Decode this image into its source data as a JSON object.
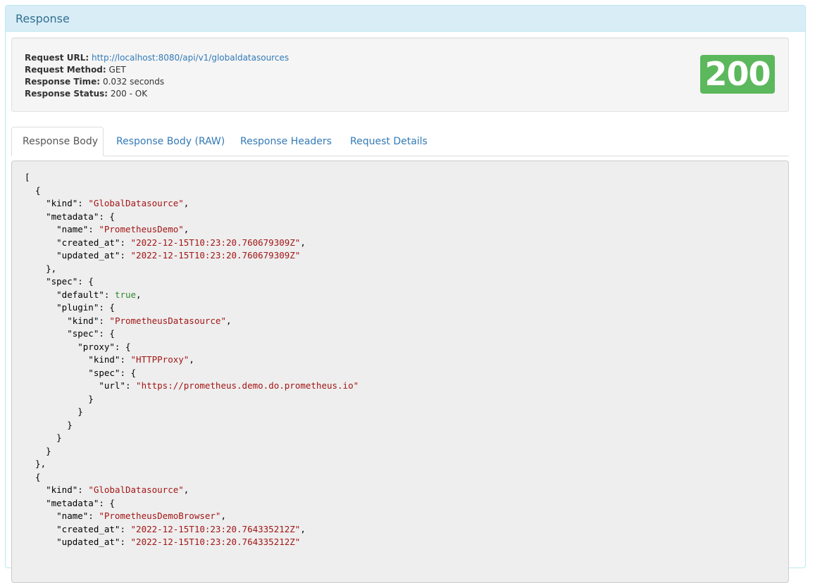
{
  "panel": {
    "title": "Response"
  },
  "summary": {
    "request_url_label": "Request URL:",
    "request_url": "http://localhost:8080/api/v1/globaldatasources",
    "request_method_label": "Request Method:",
    "request_method": "GET",
    "response_time_label": "Response Time:",
    "response_time": "0.032 seconds",
    "response_status_label": "Response Status:",
    "response_status": "200 - OK",
    "status_code": "200",
    "status_color": "#5cb85c"
  },
  "tabs": [
    {
      "label": "Response Body",
      "active": true
    },
    {
      "label": "Response Body (RAW)",
      "active": false
    },
    {
      "label": "Response Headers",
      "active": false
    },
    {
      "label": "Request Details",
      "active": false
    }
  ],
  "body_lines": [
    [
      {
        "t": "p",
        "v": "["
      }
    ],
    [
      {
        "t": "p",
        "v": "  {"
      }
    ],
    [
      {
        "t": "p",
        "v": "    \"kind\": "
      },
      {
        "t": "s",
        "v": "\"GlobalDatasource\""
      },
      {
        "t": "p",
        "v": ","
      }
    ],
    [
      {
        "t": "p",
        "v": "    \"metadata\": {"
      }
    ],
    [
      {
        "t": "p",
        "v": "      \"name\": "
      },
      {
        "t": "s",
        "v": "\"PrometheusDemo\""
      },
      {
        "t": "p",
        "v": ","
      }
    ],
    [
      {
        "t": "p",
        "v": "      \"created_at\": "
      },
      {
        "t": "s",
        "v": "\"2022-12-15T10:23:20.760679309Z\""
      },
      {
        "t": "p",
        "v": ","
      }
    ],
    [
      {
        "t": "p",
        "v": "      \"updated_at\": "
      },
      {
        "t": "s",
        "v": "\"2022-12-15T10:23:20.760679309Z\""
      }
    ],
    [
      {
        "t": "p",
        "v": "    },"
      }
    ],
    [
      {
        "t": "p",
        "v": "    \"spec\": {"
      }
    ],
    [
      {
        "t": "p",
        "v": "      \"default\": "
      },
      {
        "t": "b",
        "v": "true"
      },
      {
        "t": "p",
        "v": ","
      }
    ],
    [
      {
        "t": "p",
        "v": "      \"plugin\": {"
      }
    ],
    [
      {
        "t": "p",
        "v": "        \"kind\": "
      },
      {
        "t": "s",
        "v": "\"PrometheusDatasource\""
      },
      {
        "t": "p",
        "v": ","
      }
    ],
    [
      {
        "t": "p",
        "v": "        \"spec\": {"
      }
    ],
    [
      {
        "t": "p",
        "v": "          \"proxy\": {"
      }
    ],
    [
      {
        "t": "p",
        "v": "            \"kind\": "
      },
      {
        "t": "s",
        "v": "\"HTTPProxy\""
      },
      {
        "t": "p",
        "v": ","
      }
    ],
    [
      {
        "t": "p",
        "v": "            \"spec\": {"
      }
    ],
    [
      {
        "t": "p",
        "v": "              \"url\": "
      },
      {
        "t": "s",
        "v": "\"https://prometheus.demo.do.prometheus.io\""
      }
    ],
    [
      {
        "t": "p",
        "v": "            }"
      }
    ],
    [
      {
        "t": "p",
        "v": "          }"
      }
    ],
    [
      {
        "t": "p",
        "v": "        }"
      }
    ],
    [
      {
        "t": "p",
        "v": "      }"
      }
    ],
    [
      {
        "t": "p",
        "v": "    }"
      }
    ],
    [
      {
        "t": "p",
        "v": "  },"
      }
    ],
    [
      {
        "t": "p",
        "v": "  {"
      }
    ],
    [
      {
        "t": "p",
        "v": "    \"kind\": "
      },
      {
        "t": "s",
        "v": "\"GlobalDatasource\""
      },
      {
        "t": "p",
        "v": ","
      }
    ],
    [
      {
        "t": "p",
        "v": "    \"metadata\": {"
      }
    ],
    [
      {
        "t": "p",
        "v": "      \"name\": "
      },
      {
        "t": "s",
        "v": "\"PrometheusDemoBrowser\""
      },
      {
        "t": "p",
        "v": ","
      }
    ],
    [
      {
        "t": "p",
        "v": "      \"created_at\": "
      },
      {
        "t": "s",
        "v": "\"2022-12-15T10:23:20.764335212Z\""
      },
      {
        "t": "p",
        "v": ","
      }
    ],
    [
      {
        "t": "p",
        "v": "      \"updated_at\": "
      },
      {
        "t": "s",
        "v": "\"2022-12-15T10:23:20.764335212Z\""
      }
    ]
  ]
}
